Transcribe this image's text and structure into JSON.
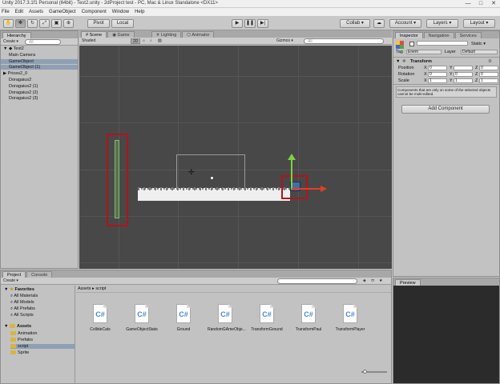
{
  "window": {
    "title": "Unity 2017.3.1f1 Personal (64bit) - Test2.unity - 2dProject test - PC, Mac & Linux Standalone <DX11>",
    "min": "—",
    "max": "□",
    "close": "✕"
  },
  "menu": [
    "File",
    "Edit",
    "Assets",
    "GameObject",
    "Component",
    "Window",
    "Help"
  ],
  "toolbar": {
    "pivot": "Pivot",
    "local": "Local",
    "collab": "Collab ▾",
    "account": "Account ▾",
    "layers": "Layers ▾",
    "layout": "Layout ▾"
  },
  "hierarchy": {
    "tab": "Hierarchy",
    "create": "Create ▾",
    "search_placeholder": "All",
    "items": [
      {
        "label": "Test2",
        "indent": 0,
        "selected": false,
        "prefix": "▼ ◆ "
      },
      {
        "label": "Main Camera",
        "indent": 1,
        "selected": false,
        "prefix": ""
      },
      {
        "label": "GameObject",
        "indent": 1,
        "selected": true,
        "prefix": ""
      },
      {
        "label": "GameObject (1)",
        "indent": 1,
        "selected": true,
        "prefix": ""
      },
      {
        "label": "Prices2_0",
        "indent": 0,
        "selected": false,
        "prefix": "▶ "
      },
      {
        "label": "Doragaius2",
        "indent": 1,
        "selected": false,
        "prefix": ""
      },
      {
        "label": "Doragaius2 (1)",
        "indent": 1,
        "selected": false,
        "prefix": ""
      },
      {
        "label": "Doragaius2 (2)",
        "indent": 1,
        "selected": false,
        "prefix": ""
      },
      {
        "label": "Doragaius2 (3)",
        "indent": 1,
        "selected": false,
        "prefix": ""
      }
    ]
  },
  "scene": {
    "tabs": [
      "Scene",
      "Game",
      "Lighting",
      "Animator"
    ],
    "shading": "Shaded",
    "mode": "2D",
    "gizmos": "Gizmos ▾",
    "search_placeholder": "All"
  },
  "inspector": {
    "tabs": [
      "Inspector",
      "Navigation",
      "Services"
    ],
    "static": "Static ▾",
    "tag_label": "Tag",
    "tag_value": "Enem",
    "layer_label": "Layer",
    "layer_value": "Default",
    "component": "Transform",
    "rows": [
      {
        "label": "Position",
        "x": "X",
        "xv": "0",
        "y": "Y",
        "yv": "",
        "z": "Z",
        "zv": "0"
      },
      {
        "label": "Rotation",
        "x": "X",
        "xv": "0",
        "y": "Y",
        "yv": "0",
        "z": "Z",
        "zv": "0"
      },
      {
        "label": "Scale",
        "x": "X",
        "xv": "1",
        "y": "Y",
        "yv": "1",
        "z": "Z",
        "zv": "1"
      }
    ],
    "note": "Components that are only on some of the selected objects cannot be multi-edited.",
    "add_component": "Add Component"
  },
  "project": {
    "tabs": [
      "Project",
      "Console"
    ],
    "create": "Create ▾",
    "favorites_label": "Favorites",
    "favorites": [
      "All Materials",
      "All Models",
      "All Prefabs",
      "All Scripts"
    ],
    "assets_label": "Assets",
    "folders": [
      "Animation",
      "Prefabs",
      "script",
      "Sprite"
    ],
    "breadcrumb": "Assets ▸ script",
    "files": [
      "CollideCats",
      "GameObjectStats",
      "Ground",
      "RandomGAmeObje...",
      "TransformGround",
      "TransformPaul",
      "TransformPlayer"
    ]
  },
  "preview": {
    "tab": "Preview"
  },
  "colors": {
    "selection": "#8fa0b5",
    "highlight_box": "#b0141a",
    "scene_bg": "#484848"
  }
}
